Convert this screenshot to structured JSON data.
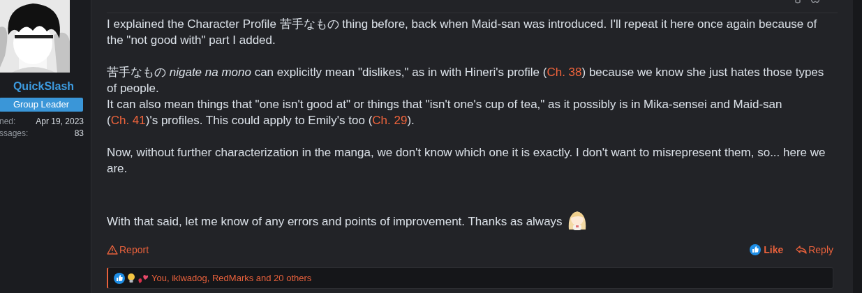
{
  "author": {
    "name": "QuickSlash",
    "role": "Group Leader",
    "stats": [
      {
        "label": "ned:",
        "value": "Apr 19, 2023"
      },
      {
        "label": "ssages:",
        "value": "83"
      }
    ]
  },
  "body": [
    {
      "kind": "text",
      "lines": [
        [
          {
            "kind": "text",
            "text": "I explained the Character Profile 苦手なもの thing before, back when Maid-san was introduced. I'll repeat it here once again because of the \"not good with\" part I added."
          }
        ]
      ]
    },
    {
      "kind": "blank"
    },
    {
      "kind": "text",
      "lines": [
        [
          {
            "kind": "text",
            "text": "苦手なもの *nigate na mono* can explicitly mean \"dislikes,\" as in with Hineri's profile ("
          },
          {
            "kind": "link",
            "text": "Ch. 38"
          },
          {
            "kind": "text",
            "text": ") because we know she just hates those types of people."
          }
        ],
        [
          {
            "kind": "text",
            "text": "It can also mean things that \"one isn't good at\" or things that \"isn't one's cup of tea,\" as it possibly is in Mika-sensei and Maid-san ("
          },
          {
            "kind": "link",
            "text": "Ch. 41"
          },
          {
            "kind": "text",
            "text": ")'s profiles. This could apply to Emily's too ("
          },
          {
            "kind": "link",
            "text": "Ch. 29"
          },
          {
            "kind": "text",
            "text": ")."
          }
        ]
      ]
    },
    {
      "kind": "blank"
    },
    {
      "kind": "text",
      "lines": [
        [
          {
            "kind": "text",
            "text": "Now, without further characterization in the manga, we don't know which one it is exactly. I don't want to misrepresent them, so... here we are."
          }
        ]
      ]
    },
    {
      "kind": "blank"
    },
    {
      "kind": "blank"
    },
    {
      "kind": "text",
      "lines": [
        [
          {
            "kind": "text",
            "text": "With that said, let me know of any errors and points of improvement. Thanks as always"
          },
          {
            "kind": "sticker"
          }
        ]
      ]
    }
  ],
  "actions": {
    "report": "Report",
    "like": "Like",
    "reply": "Reply",
    "liked": true
  },
  "reactions": {
    "icons": [
      {
        "kind": "like"
      },
      {
        "kind": "idea"
      },
      {
        "kind": "love"
      }
    ],
    "text": "You, iklwadog, RedMarks and 20 others"
  }
}
